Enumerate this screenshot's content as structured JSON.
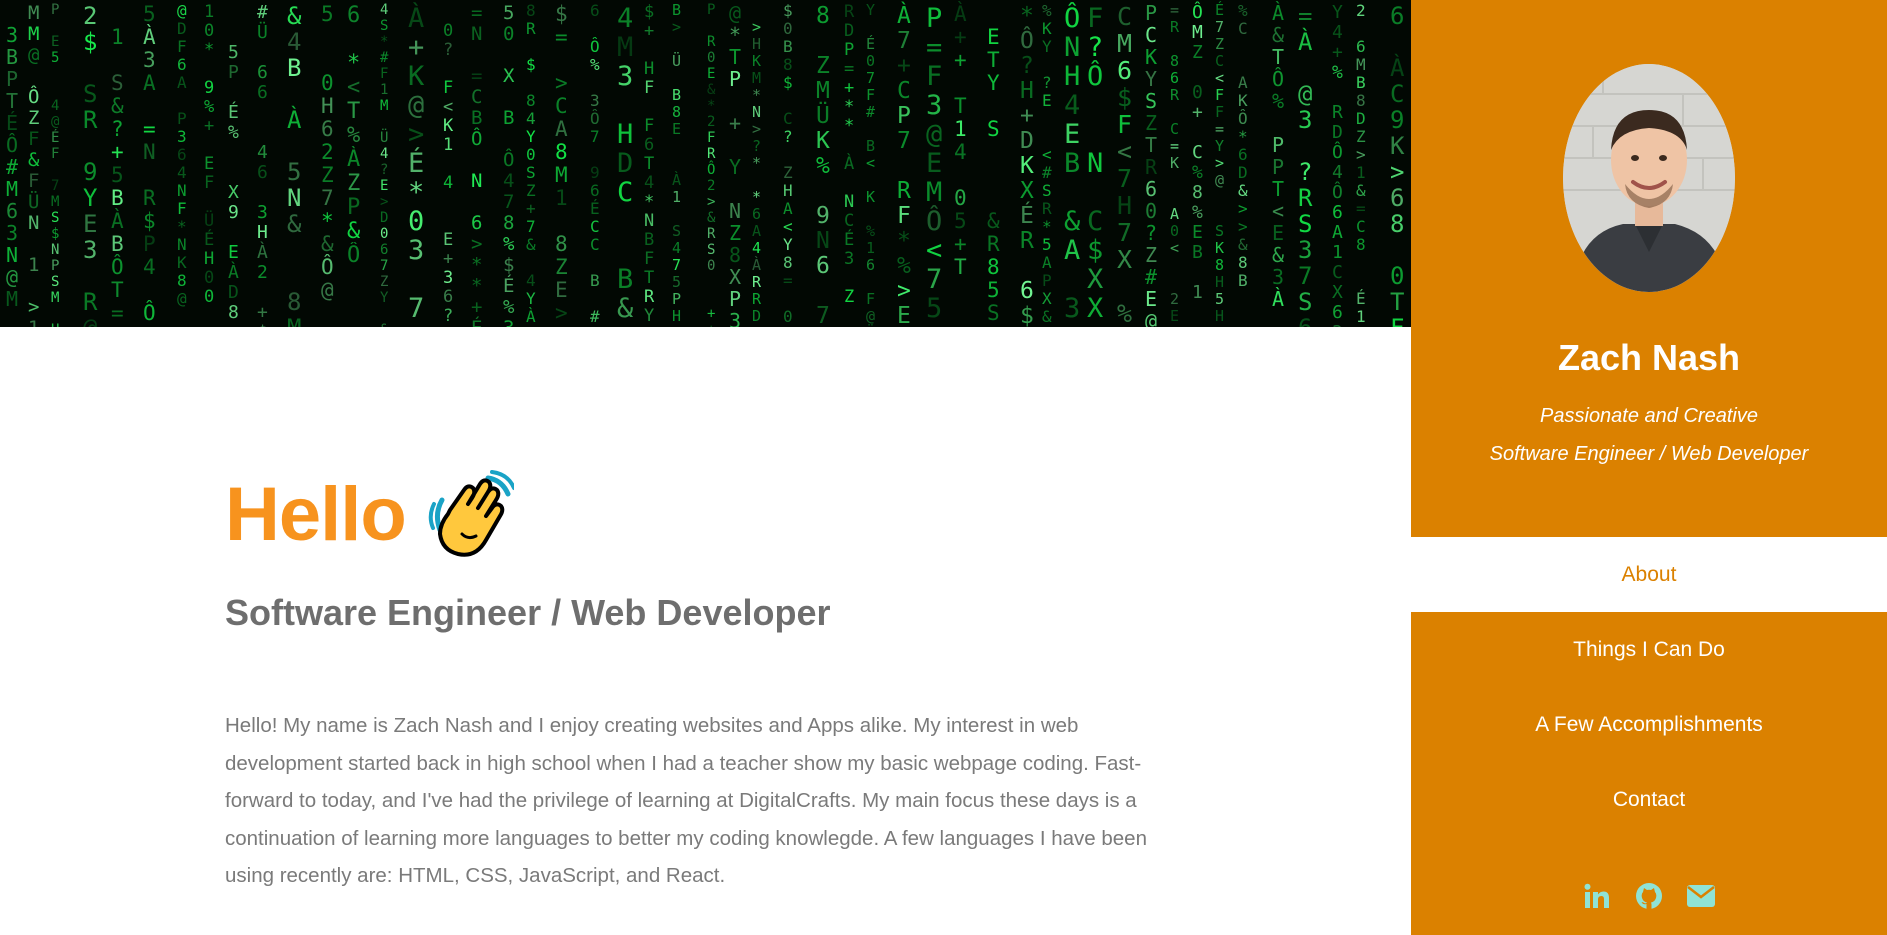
{
  "main": {
    "greeting": "Hello",
    "wave_icon": "waving-hand-icon",
    "subtitle": "Software Engineer / Web Developer",
    "bio": "Hello! My name is Zach Nash and I enjoy creating websites and Apps alike. My interest in web development started back in high school when I had a teacher show my basic webpage coding. Fast-forward to today, and I've had the privilege of learning at DigitalCrafts. My main focus these days is a continuation of learning more languages to better my coding knowlegde. A few languages I have been using recently are: HTML, CSS, JavaScript, and React."
  },
  "sidebar": {
    "name": "Zach Nash",
    "tagline_1": "Passionate and Creative",
    "tagline_2": "Software Engineer / Web Developer",
    "nav": [
      {
        "label": "About",
        "active": true
      },
      {
        "label": "Things I Can Do",
        "active": false
      },
      {
        "label": "A Few Accomplishments",
        "active": false
      },
      {
        "label": "Contact",
        "active": false
      }
    ],
    "socials": [
      "linkedin-icon",
      "github-icon",
      "envelope-icon"
    ]
  },
  "colors": {
    "accent": "#f7931e",
    "sidebar_bg": "#db8100",
    "social_icon": "#8fe3d6",
    "text_gray": "#7a7a7a",
    "heading_gray": "#6e6e6e"
  }
}
